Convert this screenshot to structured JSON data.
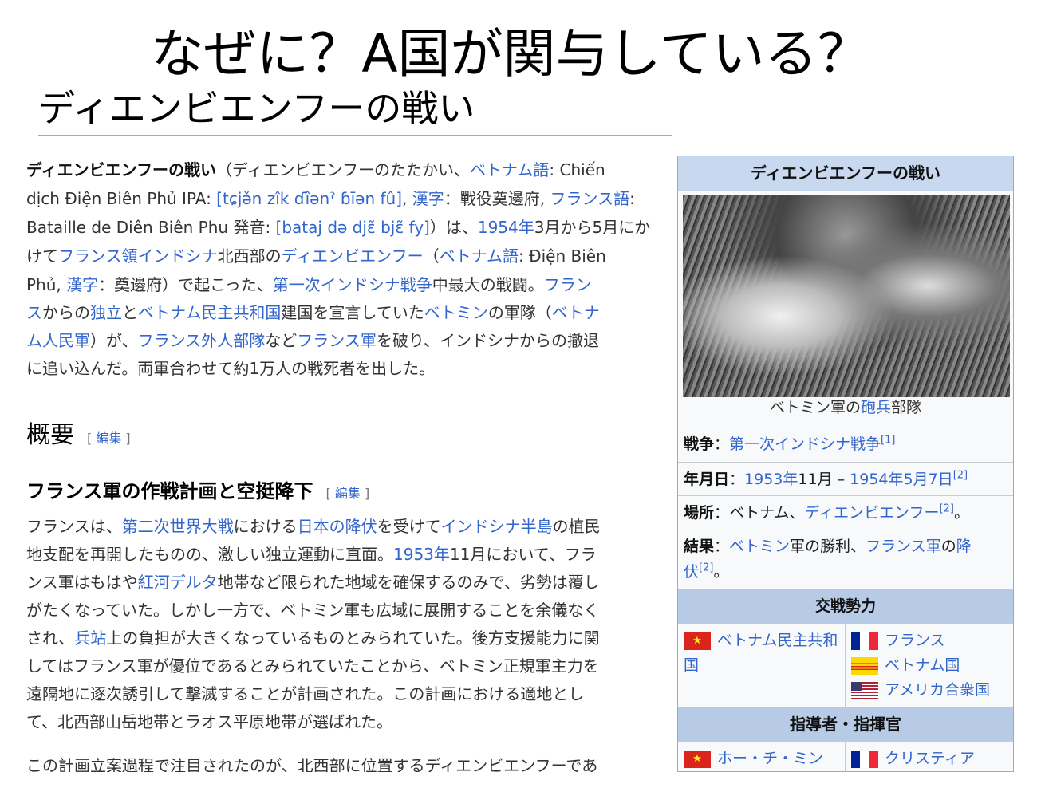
{
  "slide": {
    "title": "なぜに？A国が関与している？",
    "subtitle": "ディエンビエンフーの戦い"
  },
  "intro": [
    [
      {
        "t": "ディエンビエンフーの戦い",
        "b": 1
      },
      {
        "t": "（ディエンビエンフーのたたかい、"
      },
      {
        "t": "ベトナム語",
        "l": 1
      },
      {
        "t": ": Chiến"
      }
    ],
    [
      {
        "t": "dịch Điện Biên Phủ IPA: "
      },
      {
        "t": "[tɕjə̌n zîk ɗîənˀ ɓīən fû]",
        "l": 1
      },
      {
        "t": ", "
      },
      {
        "t": "漢字",
        "l": 1
      },
      {
        "t": "：戰役奠邊府, "
      },
      {
        "t": "フランス語",
        "l": 1
      },
      {
        "t": ":"
      }
    ],
    [
      {
        "t": "Bataille de Diên Biên Phu 発音: "
      },
      {
        "t": "[bataj də djɛ̃ bjɛ̃ fy]",
        "l": 1
      },
      {
        "t": "）は、"
      },
      {
        "t": "1954年",
        "l": 1
      },
      {
        "t": "3月から5月にか"
      }
    ],
    [
      {
        "t": "けて"
      },
      {
        "t": "フランス領インドシナ",
        "l": 1
      },
      {
        "t": "北西部の"
      },
      {
        "t": "ディエンビエンフー",
        "l": 1
      },
      {
        "t": "（"
      },
      {
        "t": "ベトナム語",
        "l": 1
      },
      {
        "t": ": Điện Biên"
      }
    ],
    [
      {
        "t": "Phủ, "
      },
      {
        "t": "漢字",
        "l": 1
      },
      {
        "t": "：奠邊府）で起こった、"
      },
      {
        "t": "第一次インドシナ戦争",
        "l": 1
      },
      {
        "t": "中最大の戦闘。"
      },
      {
        "t": "フラン",
        "l": 1
      }
    ],
    [
      {
        "t": "ス",
        "l": 1
      },
      {
        "t": "からの"
      },
      {
        "t": "独立",
        "l": 1
      },
      {
        "t": "と"
      },
      {
        "t": "ベトナム民主共和国",
        "l": 1
      },
      {
        "t": "建国を宣言していた"
      },
      {
        "t": "ベトミン",
        "l": 1
      },
      {
        "t": "の軍隊（"
      },
      {
        "t": "ベトナ",
        "l": 1
      }
    ],
    [
      {
        "t": "ム人民軍",
        "l": 1
      },
      {
        "t": "）が、"
      },
      {
        "t": "フランス外人部隊",
        "l": 1
      },
      {
        "t": "など"
      },
      {
        "t": "フランス軍",
        "l": 1
      },
      {
        "t": "を破り、インドシナからの撤退"
      }
    ],
    [
      {
        "t": "に追い込んだ。両軍合わせて約1万人の戦死者を出した。"
      }
    ]
  ],
  "overview": {
    "heading": "概要",
    "edit_open": "[ ",
    "edit": "編集",
    "edit_close": " ]"
  },
  "section": {
    "heading": "フランス軍の作戦計画と空挺降下",
    "edit_open": "[ ",
    "edit": "編集",
    "edit_close": " ]"
  },
  "section_text": [
    [
      {
        "t": "フランスは、"
      },
      {
        "t": "第二次世界大戦",
        "l": 1
      },
      {
        "t": "における"
      },
      {
        "t": "日本の降伏",
        "l": 1
      },
      {
        "t": "を受けて"
      },
      {
        "t": "インドシナ半島",
        "l": 1
      },
      {
        "t": "の植民"
      }
    ],
    [
      {
        "t": "地支配を再開したものの、激しい独立運動に直面。"
      },
      {
        "t": "1953年",
        "l": 1
      },
      {
        "t": "11月において、フラ"
      }
    ],
    [
      {
        "t": "ンス軍はもはや"
      },
      {
        "t": "紅河デルタ",
        "l": 1
      },
      {
        "t": "地帯など限られた地域を確保するのみで、劣勢は覆し"
      }
    ],
    [
      {
        "t": "がたくなっていた。しかし一方で、ベトミン軍も広域に展開することを余儀なく"
      }
    ],
    [
      {
        "t": "され、"
      },
      {
        "t": "兵站",
        "l": 1
      },
      {
        "t": "上の負担が大きくなっているものとみられていた。後方支援能力に関"
      }
    ],
    [
      {
        "t": "してはフランス軍が優位であるとみられていたことから、ベトミン正規軍主力を"
      }
    ],
    [
      {
        "t": "遠隔地に逐次誘引して撃滅することが計画された。この計画における適地とし"
      }
    ],
    [
      {
        "t": "て、北西部山岳地帯とラオス平原地帯が選ばれた。"
      }
    ],
    [
      {
        "t": "この計画立案過程で注目されたのが、北西部に位置するディエンビエンフーであ"
      }
    ]
  ],
  "infobox": {
    "title": "ディエンビエンフーの戦い",
    "caption": [
      {
        "t": "ベトミン軍の"
      },
      {
        "t": "砲兵",
        "l": 1
      },
      {
        "t": "部隊"
      }
    ],
    "war": [
      {
        "t": "戦争",
        "b": 1
      },
      {
        "t": "："
      },
      {
        "t": "第一次インドシナ戦争",
        "l": 1
      },
      {
        "t": "[1]",
        "l": 1,
        "s": 1
      }
    ],
    "date": [
      {
        "t": "年月日",
        "b": 1
      },
      {
        "t": "："
      },
      {
        "t": "1953年",
        "l": 1
      },
      {
        "t": "11月 – "
      },
      {
        "t": "1954年5月7日",
        "l": 1
      },
      {
        "t": "[2]",
        "l": 1,
        "s": 1
      }
    ],
    "place": [
      {
        "t": "場所",
        "b": 1
      },
      {
        "t": "：ベトナム、"
      },
      {
        "t": "ディエンビエンフー",
        "l": 1
      },
      {
        "t": "[2]",
        "l": 1,
        "s": 1
      },
      {
        "t": "。"
      }
    ],
    "result1": [
      {
        "t": "結果",
        "b": 1
      },
      {
        "t": "："
      },
      {
        "t": "ベトミン",
        "l": 1
      },
      {
        "t": "軍の勝利、"
      },
      {
        "t": "フランス軍",
        "l": 1
      },
      {
        "t": "の"
      },
      {
        "t": "降",
        "l": 1
      }
    ],
    "result2": [
      {
        "t": "伏",
        "l": 1
      },
      {
        "t": "[2]",
        "l": 1,
        "s": 1
      },
      {
        "t": "。"
      }
    ],
    "belligerents_heading": "交戦勢力",
    "side1": [
      "ベトナム民主共和国"
    ],
    "side2": [
      "フランス",
      "ベトナム国",
      "アメリカ合衆国"
    ],
    "commanders_heading": "指導者・指揮官",
    "cmd1": "ホー・チ・ミン",
    "cmd2": "クリスティア"
  },
  "colors": {
    "link": "#3366cc",
    "infobox_header": "#c8d8ef",
    "infobox_section": "#b7cbe6"
  }
}
